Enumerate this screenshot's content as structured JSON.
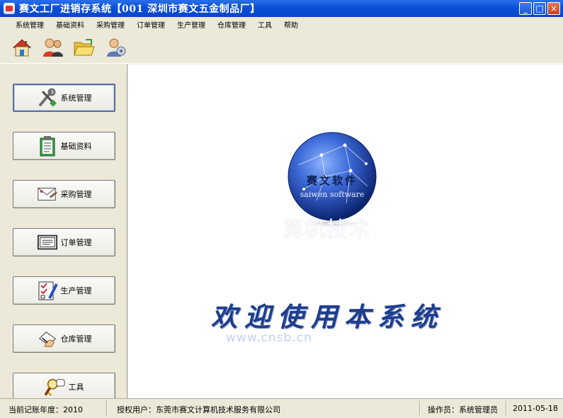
{
  "window": {
    "title": "赛文工厂进销存系统【001 深圳市赛文五金制品厂】",
    "minimize": "_",
    "maximize": "□",
    "close": "×"
  },
  "menu": [
    "系统管理",
    "基础资料",
    "采购管理",
    "订单管理",
    "生产管理",
    "仓库管理",
    "工具",
    "帮助"
  ],
  "toolbar": {
    "icons": [
      "home-icon",
      "users-icon",
      "folder-open-icon",
      "user-settings-icon"
    ]
  },
  "sidebar": {
    "items": [
      {
        "label": "系统管理",
        "icon": "tools-icon"
      },
      {
        "label": "基础资料",
        "icon": "clipboard-icon"
      },
      {
        "label": "采购管理",
        "icon": "envelope-icon"
      },
      {
        "label": "订单管理",
        "icon": "document-icon"
      },
      {
        "label": "生产管理",
        "icon": "checklist-icon"
      },
      {
        "label": "仓库管理",
        "icon": "hand-writing-icon"
      },
      {
        "label": "工具",
        "icon": "magnifier-icon"
      }
    ]
  },
  "main": {
    "logo_cn": "赛文软件",
    "logo_en": "saiwen software",
    "watermark": "算机技术",
    "welcome": "欢迎使用本系统",
    "website": "www.cnsb.cn"
  },
  "status": {
    "fiscal_year": "当前记账年度：2010",
    "licensee": "授权用户：东莞市赛文计算机技术服务有限公司",
    "operator": "操作员：系统管理员",
    "date": "2011-05-18"
  },
  "colors": {
    "titlebar": "#0a4fd8",
    "welcome_text": "#1e3d8c",
    "globe": "#2d5cc8"
  }
}
